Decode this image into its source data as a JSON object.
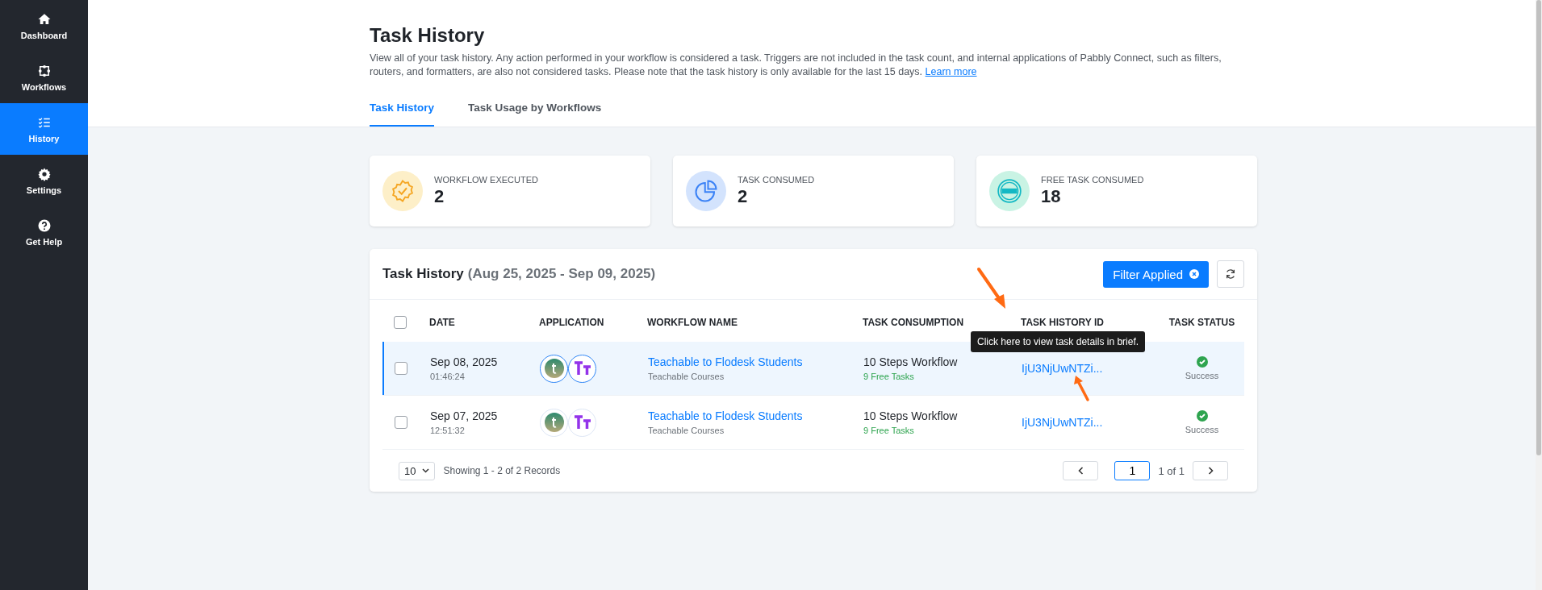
{
  "sidebar": {
    "items": [
      {
        "label": "Dashboard",
        "selected": false
      },
      {
        "label": "Workflows",
        "selected": false
      },
      {
        "label": "History",
        "selected": true
      },
      {
        "label": "Settings",
        "selected": false
      },
      {
        "label": "Get Help",
        "selected": false
      }
    ]
  },
  "header": {
    "title": "Task History",
    "description": "View all of your task history. Any action performed in your workflow is considered a task. Triggers are not included in the task count, and internal applications of Pabbly Connect, such as filters, routers, and formatters, are also not considered tasks. Please note that the task history is only available for the last 15 days.",
    "link": "Learn more"
  },
  "tabs": [
    {
      "label": "Task History",
      "selected": true
    },
    {
      "label": "Task Usage by Workflows",
      "selected": false
    }
  ],
  "stats": [
    {
      "kind": "badge",
      "label": "WORKFLOW EXECUTED",
      "value": "2"
    },
    {
      "kind": "pie",
      "label": "TASK CONSUMED",
      "value": "2"
    },
    {
      "kind": "free",
      "label": "FREE TASK CONSUMED",
      "value": "18"
    }
  ],
  "table": {
    "title": "Task History",
    "range": "(Aug 25, 2025 - Sep 09, 2025)",
    "filter_button": "Filter Applied",
    "select_all_checked": false,
    "columns": [
      "DATE",
      "APPLICATION",
      "WORKFLOW NAME",
      "TASK CONSUMPTION",
      "TASK HISTORY ID",
      "TASK STATUS"
    ],
    "rows": [
      {
        "selected": true,
        "checked": false,
        "date": "Sep 08, 2025",
        "time": "01:46:24",
        "workflow": "Teachable to Flodesk Students",
        "folder": "Teachable Courses",
        "consumption": "10 Steps Workflow",
        "free": "9 Free Tasks",
        "id": "IjU3NjUwNTZi...",
        "status": "Success",
        "kind": "success"
      },
      {
        "selected": false,
        "checked": false,
        "date": "Sep 07, 2025",
        "time": "12:51:32",
        "workflow": "Teachable to Flodesk Students",
        "folder": "Teachable Courses",
        "consumption": "10 Steps Workflow",
        "free": "9 Free Tasks",
        "id": "IjU3NjUwNTZi...",
        "status": "Success",
        "kind": "success"
      }
    ],
    "tooltip": "Click here to view task details in brief.",
    "pagination": {
      "per_page": "10",
      "summary": "Showing 1 - 2 of 2 Records",
      "page": "1",
      "of": "1 of 1"
    }
  }
}
